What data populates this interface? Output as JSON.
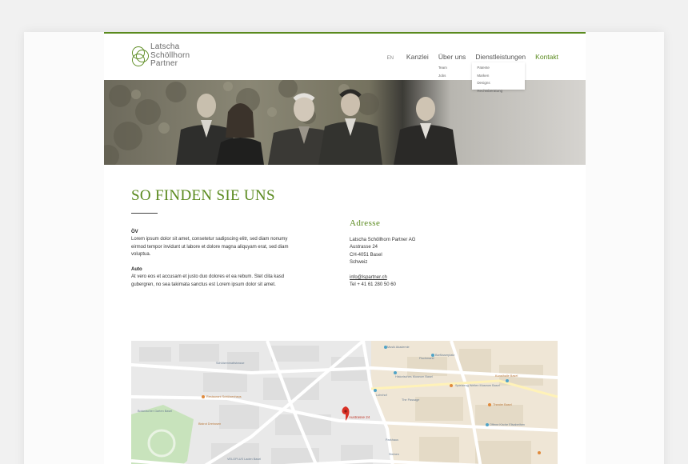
{
  "logo": {
    "line1": "Latscha",
    "line2": "Schöllhorn",
    "line3": "Partner"
  },
  "nav": {
    "lang": "EN",
    "items": [
      "Kanzlei",
      "Über uns",
      "Dienstleistungen",
      "Kontakt"
    ],
    "ueber_sub": [
      "Team",
      "Jobs"
    ],
    "dienst_sub": [
      "Patente",
      "Marken",
      "Designs",
      "Rechtsberatung"
    ]
  },
  "page": {
    "title": "SO FINDEN SIE UNS",
    "ov_heading": "ÖV",
    "ov_text": "Lorem ipsum dolor sit amet, consetetur sadipscing elitr, sed diam nonumy eirmod tempor invidunt ut labore et dolore magna aliquyam erat, sed diam voluptua.",
    "auto_heading": "Auto",
    "auto_text": "At vero eos et accusam et justo duo dolores et ea rebum. Stet clita kasd gubergren, no sea takimata sanctus est Lorem ipsum dolor sit amet."
  },
  "address": {
    "title": "Adresse",
    "company": "Latscha Schöllhorn Partner AG",
    "street": "Austrasse 24",
    "city": "CH-4051 Basel",
    "country": "Schweiz",
    "email": "info@lspartner.ch",
    "phone": "Tel + 41 61 280 50 60"
  },
  "map": {
    "pin_label": "Austrasse 24",
    "pois": [
      "Musik Akademie",
      "Lohnhof",
      "Historisches Museum Basel",
      "Barfüsserplatz",
      "Kunsthalle Basel",
      "Theater Basel",
      "Offene Kirche Elisabethen",
      "Spielzeug Welten Museum Basel",
      "Schützenmattstrasse",
      "Restaurant Schützenhaus",
      "Botanischer Garten Basel",
      "Bistrot Dreirosen",
      "VELOPLUS Laden Basel",
      "Fischmarkt",
      "The Passage",
      "Parkhaus",
      "Steinen"
    ]
  },
  "colors": {
    "accent": "#5a8a1e",
    "pin": "#d93025"
  }
}
